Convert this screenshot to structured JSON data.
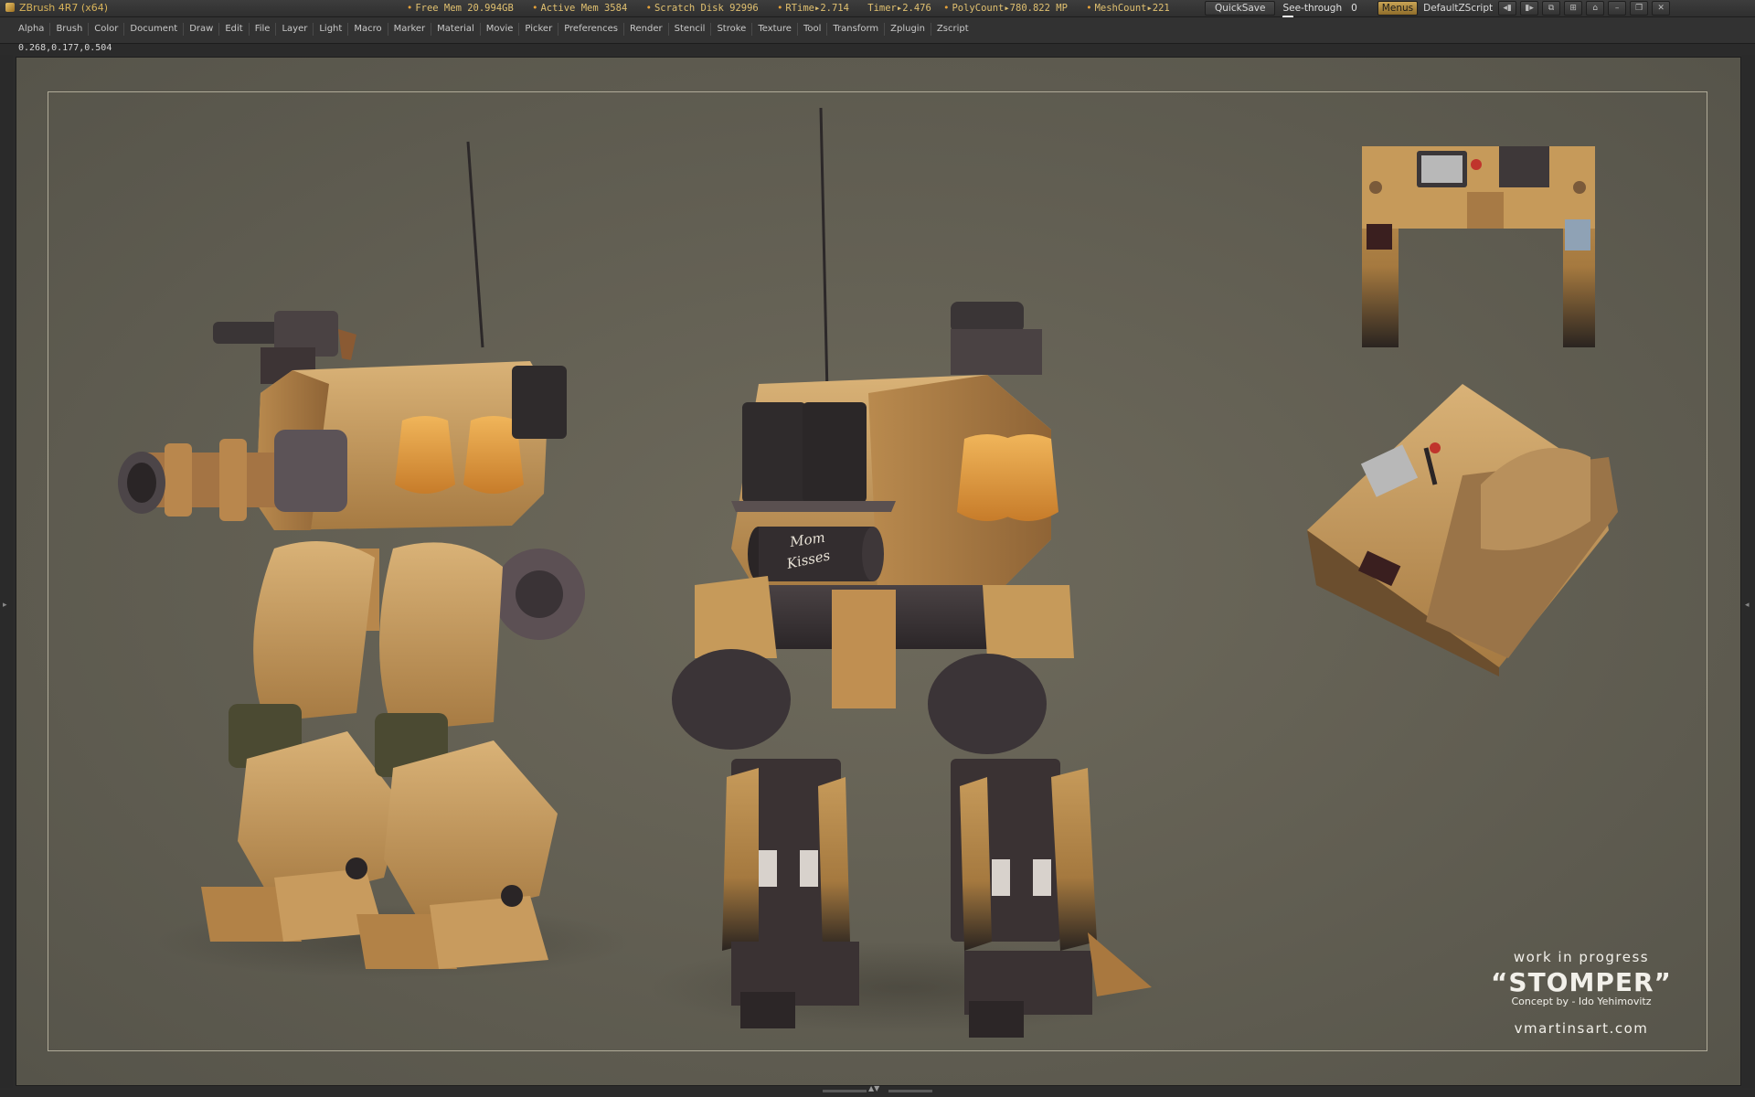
{
  "app": {
    "title": "ZBrush 4R7 (x64)"
  },
  "status": {
    "free_mem": "Free Mem 20.994GB",
    "active_mem": "Active Mem 3584",
    "scratch_disk": "Scratch Disk 92996",
    "rtime": "RTime▸2.714",
    "timer": "Timer▸2.476",
    "polycount": "PolyCount▸780.822 MP",
    "meshcount": "MeshCount▸221"
  },
  "toolbar": {
    "quicksave": "QuickSave",
    "see_through_label": "See-through",
    "see_through_value": "0",
    "menus": "Menus",
    "default_zscript": "DefaultZScript"
  },
  "menus": [
    "Alpha",
    "Brush",
    "Color",
    "Document",
    "Draw",
    "Edit",
    "File",
    "Layer",
    "Light",
    "Macro",
    "Marker",
    "Material",
    "Movie",
    "Picker",
    "Preferences",
    "Render",
    "Stencil",
    "Stroke",
    "Texture",
    "Tool",
    "Transform",
    "Zplugin",
    "Zscript"
  ],
  "coords": "0.268,0.177,0.504",
  "art": {
    "mug_text_1": "Mom",
    "mug_text_2": "Kisses"
  },
  "caption": {
    "wip": "work in progress",
    "title": "“STOMPER”",
    "concept": "Concept by - Ido Yehimovitz",
    "site": "vmartinsart.com"
  },
  "colors": {
    "canvas": "#615e52",
    "tan": "#c69a5a",
    "dark_metal": "#3b3536",
    "accent": "#e9c46a"
  },
  "icons": {
    "logo": "zbrush-logo-icon",
    "minimize": "minimize-icon",
    "restore": "restore-icon",
    "close": "close-icon"
  }
}
